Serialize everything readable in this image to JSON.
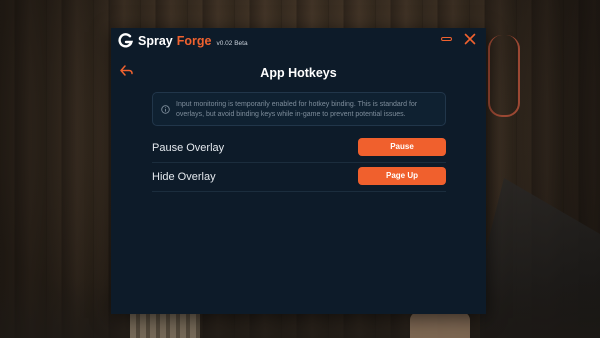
{
  "app": {
    "name_part1": "Spray",
    "name_part2": "Forge",
    "version": "v0.02 Beta",
    "accent_color": "#f0622f"
  },
  "titlebar": {
    "icons": [
      "spray-forge-logo-icon",
      "minimize-icon",
      "close-icon"
    ]
  },
  "page": {
    "back_icon": "back-arrow-icon",
    "title": "App Hotkeys",
    "info": {
      "icon": "info-icon",
      "text": "Input monitoring is temporarily enabled for hotkey binding. This is standard for overlays, but avoid binding keys while in-game to prevent potential issues."
    },
    "hotkeys": [
      {
        "label": "Pause Overlay",
        "key": "Pause"
      },
      {
        "label": "Hide Overlay",
        "key": "Page Up"
      }
    ]
  }
}
